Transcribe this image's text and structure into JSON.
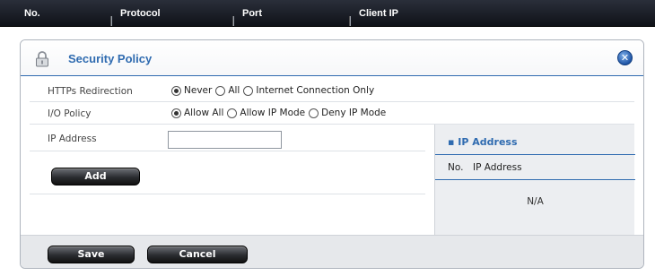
{
  "table_header": {
    "columns": [
      "No.",
      "Protocol",
      "Port",
      "Client IP"
    ]
  },
  "dialog": {
    "title": "Security Policy",
    "close_icon": "close-icon",
    "lock_icon": "lock-icon",
    "https_redirection": {
      "label": "HTTPs Redirection",
      "options": [
        "Never",
        "All",
        "Internet Connection Only"
      ],
      "selected": "Never"
    },
    "io_policy": {
      "label": "I/O Policy",
      "options": [
        "Allow All",
        "Allow IP Mode",
        "Deny IP Mode"
      ],
      "selected": "Allow All"
    },
    "ip_address": {
      "label": "IP Address",
      "value": ""
    },
    "add_label": "Add",
    "ip_panel": {
      "title": "IP Address",
      "columns": [
        "No.",
        "IP Address"
      ],
      "empty_text": "N/A"
    },
    "save_label": "Save",
    "cancel_label": "Cancel"
  },
  "colors": {
    "accent": "#2f6bb0",
    "header_bg": "#1a1e26"
  }
}
